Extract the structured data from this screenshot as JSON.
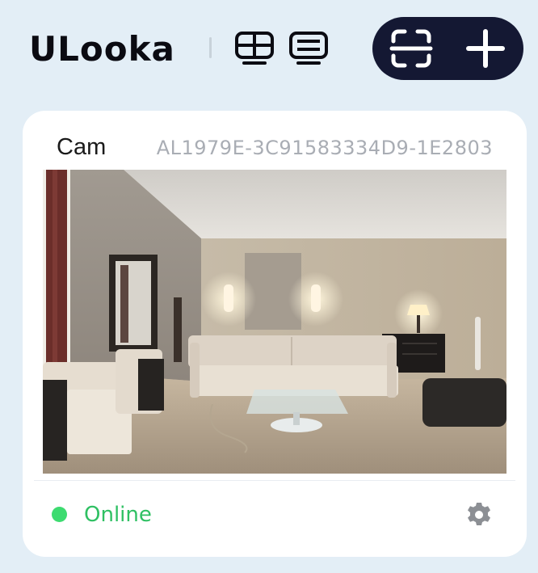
{
  "header": {
    "app_title": "ULooka",
    "view_buttons": [
      {
        "icon": "grid-view-monitor-icon"
      },
      {
        "icon": "list-view-monitor-icon"
      }
    ],
    "actions": [
      {
        "icon": "scan-icon"
      },
      {
        "icon": "plus-icon"
      }
    ]
  },
  "camera_card": {
    "name": "Cam",
    "device_id": "AL1979E-3C91583334D9-1E2803",
    "preview": "living-room-camera-preview",
    "status": "Online",
    "status_color": "#3ddb70",
    "settings_icon": "gear-icon"
  },
  "colors": {
    "background": "#e3eef6",
    "pill": "#141833",
    "card": "#ffffff",
    "online": "#2fc063"
  }
}
